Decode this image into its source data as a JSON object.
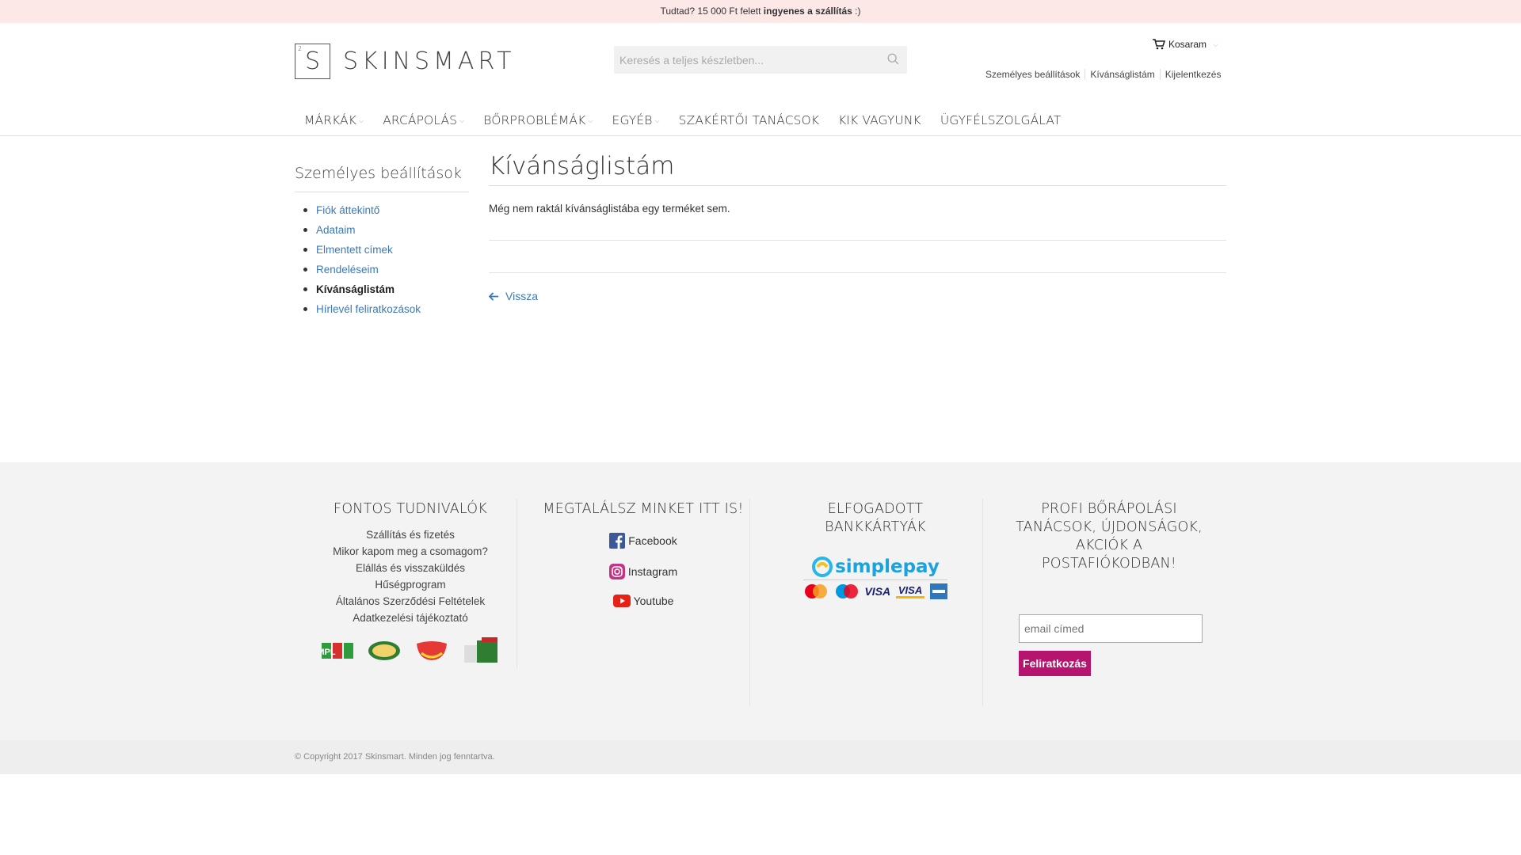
{
  "promo": {
    "prefix": "Tudtad? 15 000 Ft felett ",
    "bold": "ingyenes a szállítás",
    "suffix": " :)"
  },
  "logo": {
    "super": "2",
    "letter": "S",
    "name": "SKINSMART"
  },
  "search": {
    "placeholder": "Keresés a teljes készletben..."
  },
  "cart": {
    "label": "Kosaram"
  },
  "toplinks": [
    "Személyes beállítások",
    "Kívánságlistám",
    "Kijelentkezés"
  ],
  "nav": [
    {
      "label": "MÁRKÁK",
      "dropdown": true
    },
    {
      "label": "ARCÁPOLÁS",
      "dropdown": true
    },
    {
      "label": "BŐRPROBLÉMÁK",
      "dropdown": true
    },
    {
      "label": "EGYÉB",
      "dropdown": true
    },
    {
      "label": "SZAKÉRTŐI TANÁCSOK",
      "dropdown": false
    },
    {
      "label": "KIK VAGYUNK",
      "dropdown": false
    },
    {
      "label": "ÜGYFÉLSZOLGÁLAT",
      "dropdown": false
    }
  ],
  "sidebar": {
    "title": "Személyes beállítások",
    "items": [
      "Fiók áttekintő",
      "Adataim",
      "Elmentett címek",
      "Rendeléseim",
      "Kívánságlistám",
      "Hírlevél feliratkozások"
    ],
    "active": "Kívánságlistám"
  },
  "main": {
    "title": "Kívánságlistám",
    "empty_text": "Még nem raktál kívánságlistába egy terméket sem.",
    "back_label": "Vissza"
  },
  "footer": {
    "col1": {
      "title": "FONTOS TUDNIVALÓK",
      "links": [
        "Szállítás és fizetés",
        "Mikor kapom meg a csomagom?",
        "Elállás és visszaküldés",
        "Hűségprogram",
        "Általános Szerződési Feltételek",
        "Adatkezelési tájékoztató"
      ],
      "logos": [
        "MPL",
        "POSTA PONT",
        "MOL",
        "CSOMAGAUTOMATA"
      ]
    },
    "col2": {
      "title": "MEGTALÁLSZ MINKET ITT IS!",
      "links": [
        "Facebook",
        "Instagram",
        "Youtube"
      ]
    },
    "col3": {
      "title_line1": "ELFOGADOTT",
      "title_line2": "BANKKÁRTYÁK",
      "brand": "simplepay",
      "cards": [
        "MasterCard",
        "Maestro",
        "VISA",
        "VISA",
        "AMEX"
      ]
    },
    "col4": {
      "title_lines": [
        "PROFI BŐRÁPOLÁSI",
        "TANÁCSOK, ÚJDONSÁGOK,",
        "AKCIÓK A",
        "POSTAFIÓKODBAN!"
      ],
      "email_placeholder": "email címed",
      "button": "Feliratkozás"
    }
  },
  "copyright": "© Copyright 2017 Skinsmart. Minden jog fenntartva.",
  "colors": {
    "accent_link": "#3a79b9",
    "subscribe": "#b5156e",
    "promo_bg": "#fde8e8"
  }
}
